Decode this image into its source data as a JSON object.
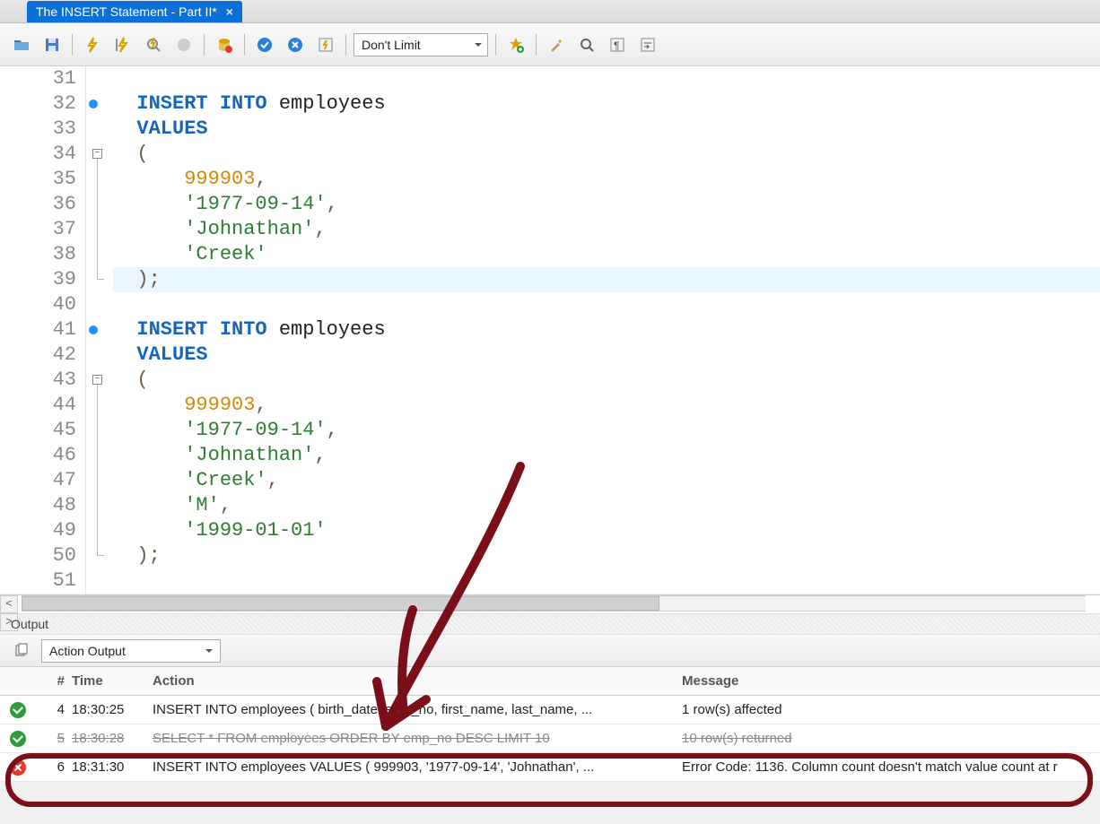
{
  "tab": {
    "title": "The INSERT Statement - Part II*"
  },
  "toolbar": {
    "limit": "Don't Limit"
  },
  "editor": {
    "lines": [
      {
        "n": 31,
        "text": ""
      },
      {
        "n": 32,
        "marker": true,
        "tokens": [
          {
            "cls": "kw",
            "t": "INSERT INTO "
          },
          {
            "cls": "ident",
            "t": "employees"
          }
        ]
      },
      {
        "n": 33,
        "tokens": [
          {
            "cls": "kw",
            "t": "VALUES"
          }
        ]
      },
      {
        "n": 34,
        "fold": "open",
        "tokens": [
          {
            "cls": "punct",
            "t": "("
          }
        ]
      },
      {
        "n": 35,
        "tokens": [
          {
            "cls": "ws",
            "t": "    "
          },
          {
            "cls": "num",
            "t": "999903"
          },
          {
            "cls": "punct",
            "t": ","
          }
        ]
      },
      {
        "n": 36,
        "tokens": [
          {
            "cls": "ws",
            "t": "    "
          },
          {
            "cls": "str",
            "t": "'1977-09-14'"
          },
          {
            "cls": "punct",
            "t": ","
          }
        ]
      },
      {
        "n": 37,
        "tokens": [
          {
            "cls": "ws",
            "t": "    "
          },
          {
            "cls": "str",
            "t": "'Johnathan'"
          },
          {
            "cls": "punct",
            "t": ","
          }
        ]
      },
      {
        "n": 38,
        "tokens": [
          {
            "cls": "ws",
            "t": "    "
          },
          {
            "cls": "str",
            "t": "'Creek'"
          }
        ]
      },
      {
        "n": 39,
        "hl": true,
        "fold": "end",
        "tokens": [
          {
            "cls": "punct",
            "t": ");"
          }
        ]
      },
      {
        "n": 40,
        "text": ""
      },
      {
        "n": 41,
        "marker": true,
        "tokens": [
          {
            "cls": "kw",
            "t": "INSERT INTO "
          },
          {
            "cls": "ident",
            "t": "employees"
          }
        ]
      },
      {
        "n": 42,
        "tokens": [
          {
            "cls": "kw",
            "t": "VALUES"
          }
        ]
      },
      {
        "n": 43,
        "fold": "open",
        "tokens": [
          {
            "cls": "punct",
            "t": "("
          }
        ]
      },
      {
        "n": 44,
        "tokens": [
          {
            "cls": "ws",
            "t": "    "
          },
          {
            "cls": "num",
            "t": "999903"
          },
          {
            "cls": "punct",
            "t": ","
          }
        ]
      },
      {
        "n": 45,
        "tokens": [
          {
            "cls": "ws",
            "t": "    "
          },
          {
            "cls": "str",
            "t": "'1977-09-14'"
          },
          {
            "cls": "punct",
            "t": ","
          }
        ]
      },
      {
        "n": 46,
        "tokens": [
          {
            "cls": "ws",
            "t": "    "
          },
          {
            "cls": "str",
            "t": "'Johnathan'"
          },
          {
            "cls": "punct",
            "t": ","
          }
        ]
      },
      {
        "n": 47,
        "tokens": [
          {
            "cls": "ws",
            "t": "    "
          },
          {
            "cls": "str",
            "t": "'Creek'"
          },
          {
            "cls": "punct",
            "t": ","
          }
        ]
      },
      {
        "n": 48,
        "tokens": [
          {
            "cls": "ws",
            "t": "    "
          },
          {
            "cls": "str",
            "t": "'M'"
          },
          {
            "cls": "punct",
            "t": ","
          }
        ]
      },
      {
        "n": 49,
        "tokens": [
          {
            "cls": "ws",
            "t": "    "
          },
          {
            "cls": "str",
            "t": "'1999-01-01'"
          }
        ]
      },
      {
        "n": 50,
        "fold": "end",
        "tokens": [
          {
            "cls": "punct",
            "t": ");"
          }
        ]
      },
      {
        "n": 51,
        "text": ""
      }
    ]
  },
  "output": {
    "label": "Output",
    "mode": "Action Output",
    "headers": {
      "idx": "#",
      "time": "Time",
      "action": "Action",
      "message": "Message"
    },
    "rows": [
      {
        "status": "ok",
        "idx": 4,
        "time": "18:30:25",
        "action": "INSERT INTO employees ( birth_date,   emp_no,   first_name,   last_name,   ...",
        "message": "1 row(s) affected"
      },
      {
        "status": "ok",
        "idx": 5,
        "time": "18:30:28",
        "strike": true,
        "action": "SELECT   * FROM   employees ORDER BY emp_no DESC LIMIT 10",
        "message": "10 row(s) returned"
      },
      {
        "status": "err",
        "idx": 6,
        "time": "18:31:30",
        "action": "INSERT INTO employees VALUES (  999903,   '1977-09-14',   'Johnathan',   ...",
        "message": "Error Code: 1136. Column count doesn't match value count at r"
      }
    ]
  }
}
